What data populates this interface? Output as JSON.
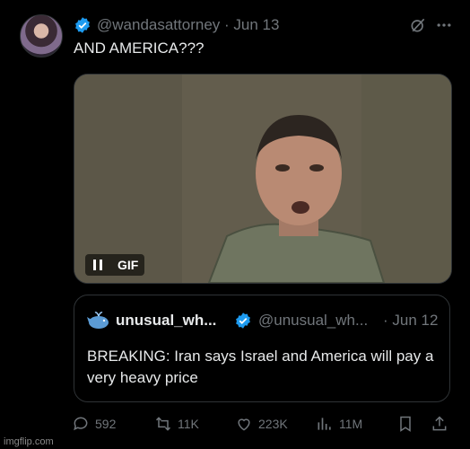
{
  "tweet": {
    "handle": "@wandasattorney · Jun 13",
    "text": "AND AMERICA???"
  },
  "media": {
    "gif_label": "GIF"
  },
  "quote": {
    "name": "unusual_wh...",
    "handle": "@unusual_wh...",
    "date": "· Jun 12",
    "text": "BREAKING: Iran says Israel and America will pay a very heavy price"
  },
  "actions": {
    "replies": "592",
    "retweets": "11K",
    "likes": "223K",
    "views": "11M"
  },
  "watermark": "imgflip.com",
  "colors": {
    "verified": "#1d9bf0",
    "text": "#e7e9ea",
    "muted": "#71767b",
    "border": "#2f3336"
  },
  "icons": [
    "verified-icon",
    "grok-icon",
    "more-icon",
    "pause-icon",
    "whale-icon",
    "reply-icon",
    "retweet-icon",
    "like-icon",
    "views-icon",
    "bookmark-icon",
    "share-icon"
  ]
}
